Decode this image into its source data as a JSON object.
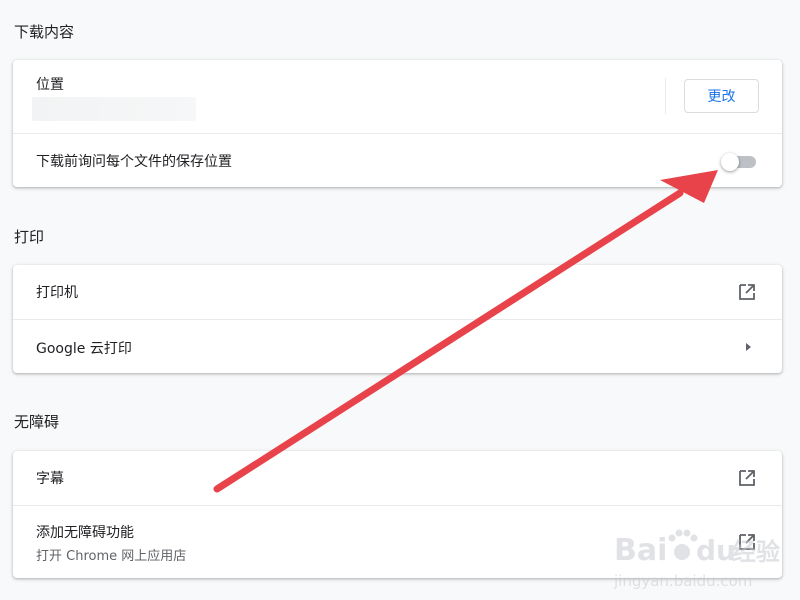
{
  "downloads": {
    "section_title": "下载内容",
    "location_label": "位置",
    "change_button": "更改",
    "ask_label": "下载前询问每个文件的保存位置",
    "ask_enabled": false
  },
  "printing": {
    "section_title": "打印",
    "printers_label": "打印机",
    "cloud_print_label": "Google 云打印"
  },
  "accessibility": {
    "section_title": "无障碍",
    "captions_label": "字幕",
    "add_features_label": "添加无障碍功能",
    "add_features_sublabel": "打开 Chrome 网上应用店"
  },
  "watermark": {
    "brand": "Bai du 经验",
    "url": "jingyan.baidu.com"
  },
  "colors": {
    "accent": "#1a73e8",
    "annotation_arrow": "#e8434a",
    "toggle_off_track": "#bdc1c6"
  },
  "icons": {
    "open_in_new": "open-in-new-icon",
    "arrow_right": "arrow-right-icon"
  }
}
